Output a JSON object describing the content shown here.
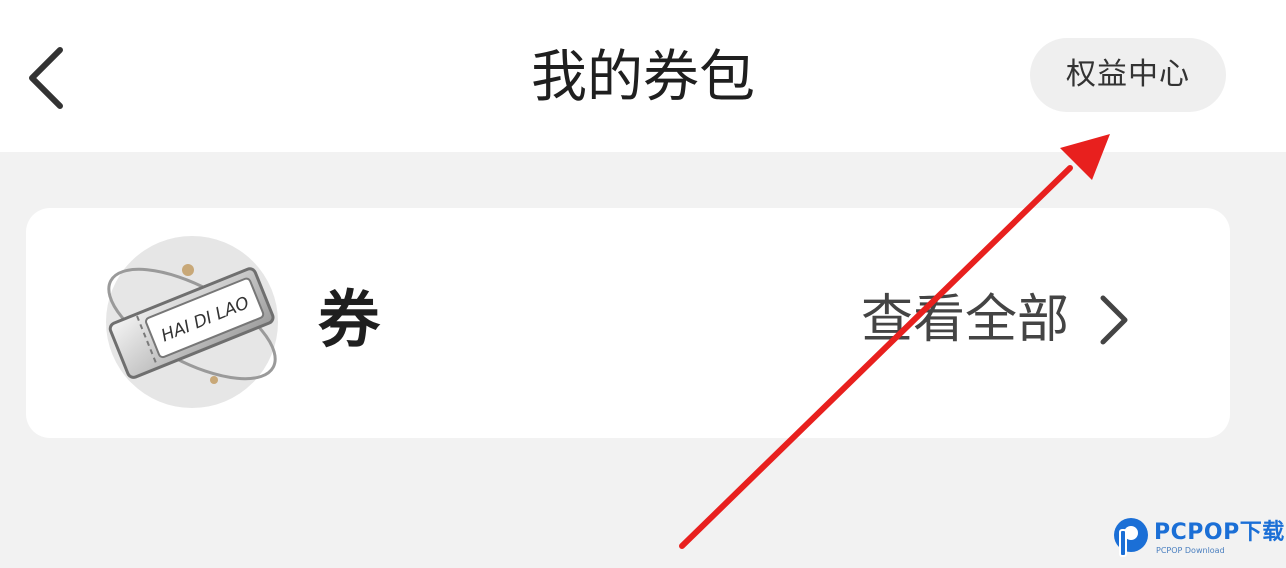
{
  "header": {
    "title": "我的券包",
    "back_icon": "chevron-left-icon",
    "benefit_center_label": "权益中心"
  },
  "coupon_section": {
    "label": "券",
    "logo_text": "HAI DI LAO",
    "view_all_label": "查看全部",
    "view_all_icon": "chevron-right-icon"
  },
  "annotation": {
    "arrow_color": "#e8201e",
    "points_to": "benefit-center-button"
  },
  "watermark": {
    "brand": "PCPOP下载",
    "subtitle": "PCPOP Download"
  },
  "colors": {
    "page_background": "#f2f2f2",
    "card_background": "#ffffff",
    "pill_background": "#efefef",
    "watermark_blue": "#1b6fd6"
  }
}
